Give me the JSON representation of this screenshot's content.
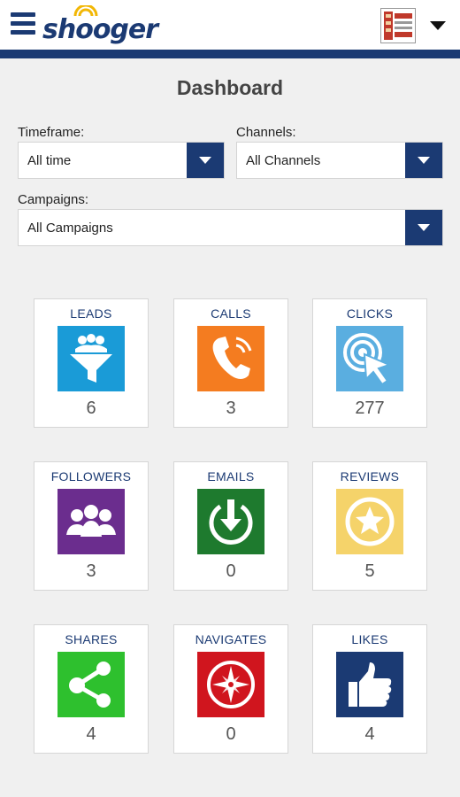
{
  "header": {
    "logo_text": "shooger",
    "menu_icon": "hamburger-icon",
    "account_icon": "caret-down-icon"
  },
  "page": {
    "title": "Dashboard"
  },
  "filters": {
    "timeframe": {
      "label": "Timeframe:",
      "value": "All time"
    },
    "channels": {
      "label": "Channels:",
      "value": "All Channels"
    },
    "campaigns": {
      "label": "Campaigns:",
      "value": "All Campaigns"
    }
  },
  "tiles": [
    {
      "label": "LEADS",
      "count": "6",
      "color": "#1a9bd7",
      "icon": "funnel-people-icon"
    },
    {
      "label": "CALLS",
      "count": "3",
      "color": "#f47c20",
      "icon": "phone-icon"
    },
    {
      "label": "CLICKS",
      "count": "277",
      "color": "#5aaee0",
      "icon": "cursor-click-icon"
    },
    {
      "label": "FOLLOWERS",
      "count": "3",
      "color": "#6b2d8e",
      "icon": "people-icon"
    },
    {
      "label": "EMAILS",
      "count": "0",
      "color": "#1e7a2e",
      "icon": "download-arrow-icon"
    },
    {
      "label": "REVIEWS",
      "count": "5",
      "color": "#f5d36a",
      "icon": "star-icon"
    },
    {
      "label": "SHARES",
      "count": "4",
      "color": "#2ec02e",
      "icon": "share-icon"
    },
    {
      "label": "NAVIGATES",
      "count": "0",
      "color": "#d0151e",
      "icon": "compass-icon"
    },
    {
      "label": "LIKES",
      "count": "4",
      "color": "#1b3a73",
      "icon": "thumbs-up-icon"
    }
  ],
  "colors": {
    "brand": "#1b3a73",
    "logo_accent": "#f2b705"
  }
}
